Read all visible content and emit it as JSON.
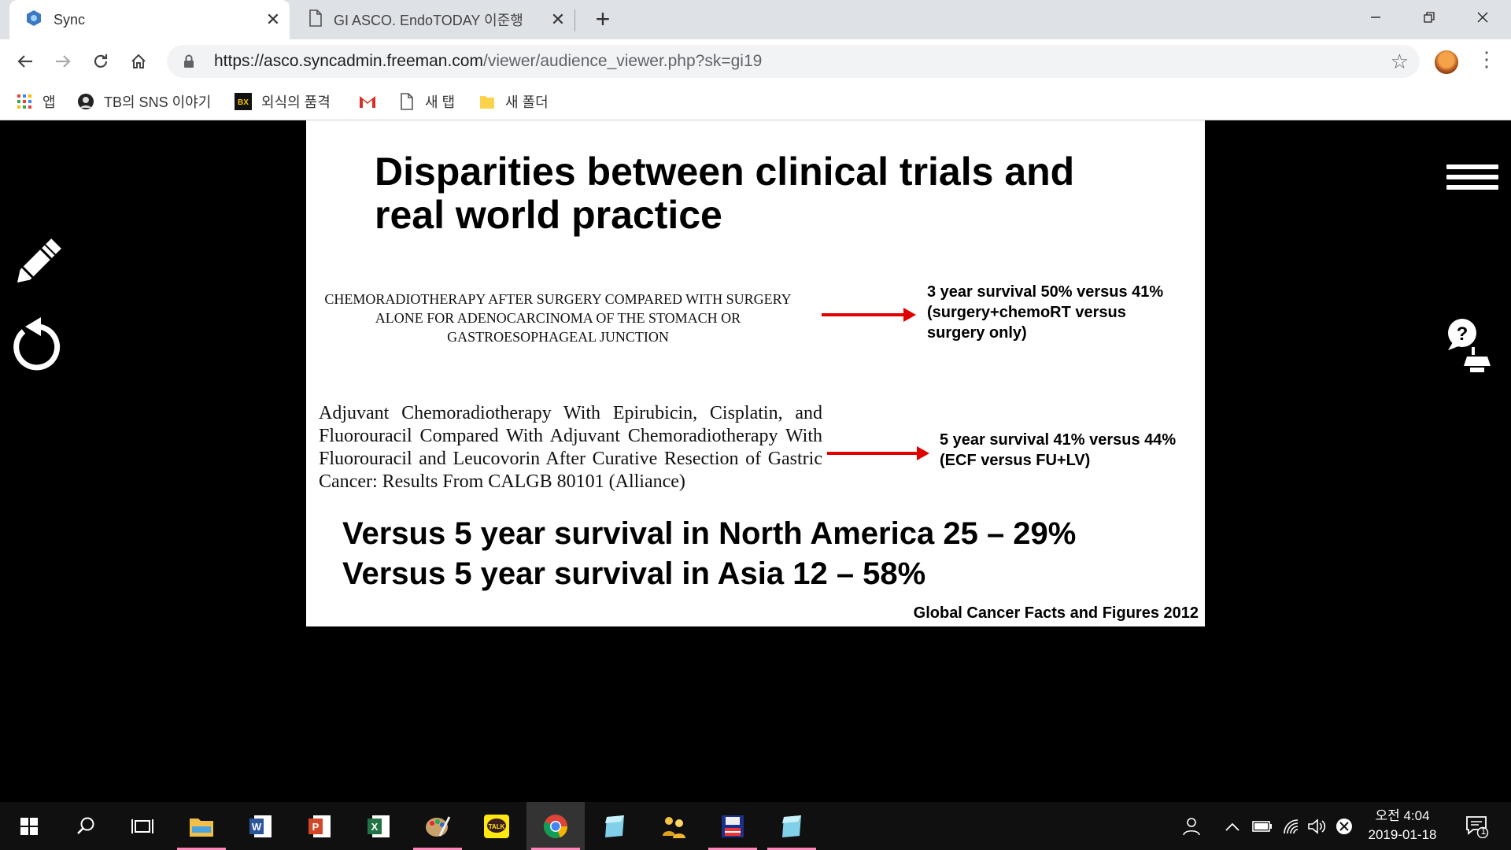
{
  "browser": {
    "tabs": [
      {
        "title": "Sync",
        "active": true
      },
      {
        "title": "GI ASCO. EndoTODAY 이준행",
        "active": false
      }
    ],
    "url_host": "https://asco.syncadmin.freeman.com",
    "url_path": "/viewer/audience_viewer.php?sk=gi19",
    "bookmarks": [
      {
        "label": "앱",
        "icon": "apps-grid-icon"
      },
      {
        "label": "TB의 SNS 이야기",
        "icon": "portrait-icon"
      },
      {
        "label": "외식의 품격",
        "icon": "bx-logo-icon"
      },
      {
        "label": "",
        "icon": "gmail-icon"
      },
      {
        "label": "새 탭",
        "icon": "page-icon"
      },
      {
        "label": "새 폴더",
        "icon": "folder-icon"
      }
    ]
  },
  "slide": {
    "title": "Disparities between clinical trials and\nreal world practice",
    "paper1": "Chemoradiotherapy after Surgery Compared with Surgery Alone for Adenocarcinoma of the Stomach or Gastroesophageal Junction",
    "result1": {
      "line1": "3 year survival 50% versus 41%",
      "line2": "(surgery+chemoRT versus",
      "line3": "surgery only)"
    },
    "paper2": "Adjuvant Chemoradiotherapy With Epirubicin, Cisplatin, and Fluorouracil Compared With Adjuvant Chemoradiotherapy With Fluorouracil and Leucovorin After Curative Resection of Gastric Cancer: Results From CALGB 80101 (Alliance)",
    "result2": {
      "line1": "5 year survival 41% versus 44%",
      "line2": "(ECF versus FU+LV)"
    },
    "versus1": "Versus 5 year survival in North America 25 – 29%",
    "versus2": "Versus 5 year survival in Asia 12 – 58%",
    "source": "Global Cancer Facts and Figures 2012"
  },
  "taskbar": {
    "apps": [
      "start-icon",
      "search-icon",
      "task-view-icon",
      "file-explorer-icon",
      "word-icon",
      "powerpoint-icon",
      "excel-icon",
      "paint-icon",
      "kakaotalk-icon",
      "chrome-icon",
      "app-icon",
      "people-icon",
      "floppy-icon",
      "app-icon-2"
    ],
    "clock_time": "오전 4:04",
    "clock_date": "2019-01-18",
    "notification_count": "1"
  },
  "colors": {
    "arrow": "#e00000",
    "tab_bg": "#dee1e6",
    "taskbar": "#101010"
  }
}
